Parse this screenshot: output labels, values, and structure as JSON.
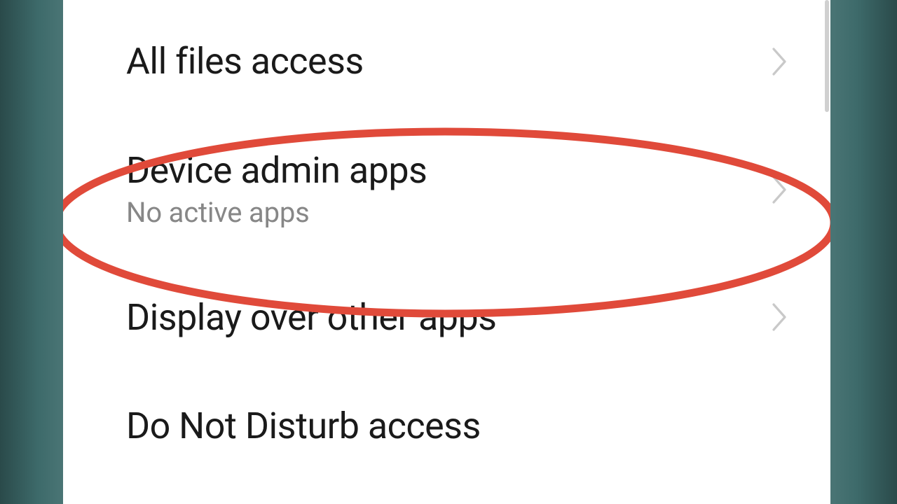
{
  "settings": {
    "items": [
      {
        "title": "All files access",
        "subtitle": null
      },
      {
        "title": "Device admin apps",
        "subtitle": "No active apps"
      },
      {
        "title": "Display over other apps",
        "subtitle": null
      },
      {
        "title": "Do Not Disturb access",
        "subtitle": null
      }
    ]
  },
  "annotation": {
    "highlighted_index": 1,
    "color": "#e04a3a"
  }
}
